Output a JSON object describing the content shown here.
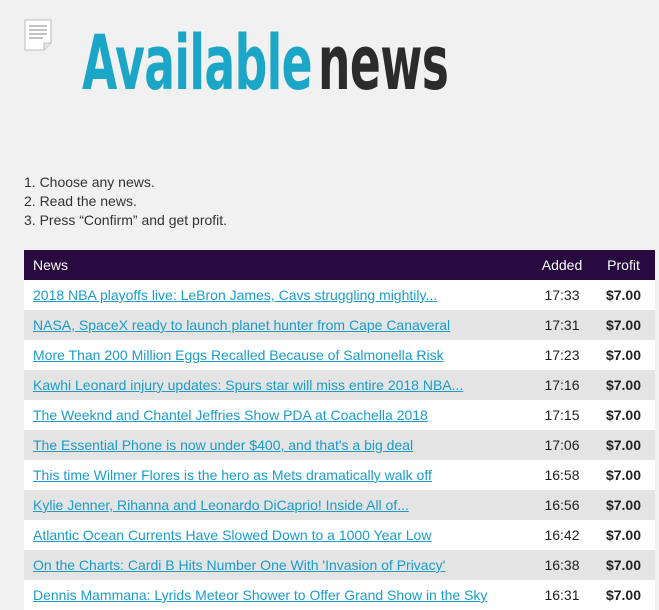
{
  "header": {
    "title_part1": "Available",
    "title_part2": "news",
    "colors": {
      "title_accent": "#1ba6c8",
      "title_dark": "#2b2b2b"
    },
    "icon": "document-icon"
  },
  "instructions": [
    "1. Choose any news.",
    "2. Read the news.",
    "3. Press “Confirm” and get profit."
  ],
  "table": {
    "header_color": "#27083f",
    "link_color": "#1b9cc9",
    "columns": {
      "news": "News",
      "added": "Added",
      "profit": "Profit"
    },
    "rows": [
      {
        "title": "2018 NBA playoffs live: LeBron James, Cavs struggling mightily...",
        "added": "17:33",
        "profit": "$7.00"
      },
      {
        "title": "NASA, SpaceX ready to launch planet hunter from Cape Canaveral",
        "added": "17:31",
        "profit": "$7.00"
      },
      {
        "title": "More Than 200 Million Eggs Recalled Because of Salmonella Risk",
        "added": "17:23",
        "profit": "$7.00"
      },
      {
        "title": "Kawhi Leonard injury updates: Spurs star will miss entire 2018 NBA...",
        "added": "17:16",
        "profit": "$7.00"
      },
      {
        "title": "The Weeknd and Chantel Jeffries Show PDA at Coachella 2018",
        "added": "17:15",
        "profit": "$7.00"
      },
      {
        "title": "The Essential Phone is now under $400, and that's a big deal",
        "added": "17:06",
        "profit": "$7.00"
      },
      {
        "title": "This time Wilmer Flores is the hero as Mets dramatically walk off",
        "added": "16:58",
        "profit": "$7.00"
      },
      {
        "title": "Kylie Jenner, Rihanna and Leonardo DiCaprio! Inside All of...",
        "added": "16:56",
        "profit": "$7.00"
      },
      {
        "title": "Atlantic Ocean Currents Have Slowed Down to a 1000 Year Low",
        "added": "16:42",
        "profit": "$7.00"
      },
      {
        "title": "On the Charts: Cardi B Hits Number One With 'Invasion of Privacy'",
        "added": "16:38",
        "profit": "$7.00"
      },
      {
        "title": "Dennis Mammana: Lyrids Meteor Shower to Offer Grand Show in the Sky",
        "added": "16:31",
        "profit": "$7.00"
      }
    ]
  }
}
